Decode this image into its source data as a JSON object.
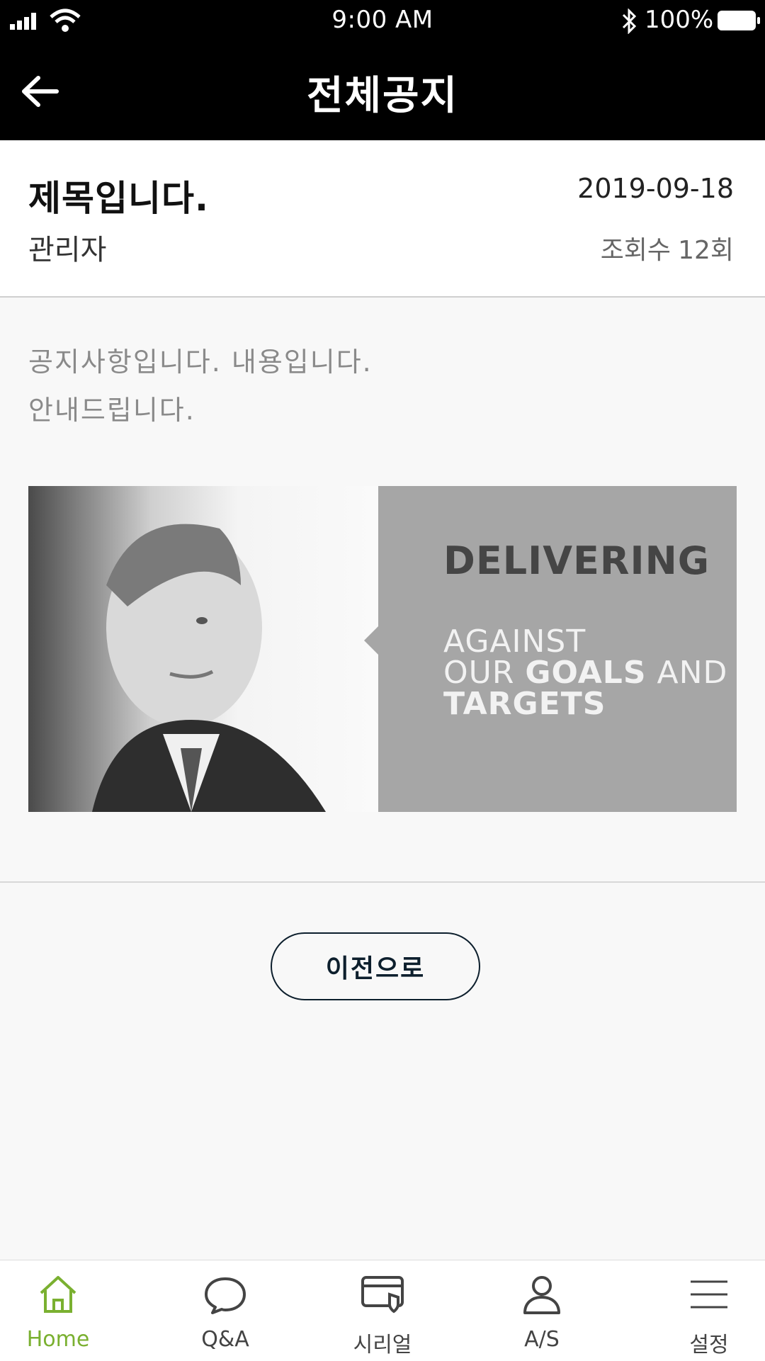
{
  "status_bar": {
    "time": "9:00 AM",
    "battery_percent": "100%"
  },
  "header": {
    "title": "전체공지"
  },
  "post": {
    "title": "제목입니다.",
    "date": "2019-09-18",
    "author": "관리자",
    "views_label": "조회수",
    "views_count": "12회",
    "content_lines": [
      "공지사항입니다. 내용입니다.",
      "안내드립니다."
    ]
  },
  "banner": {
    "headline": "DELIVERING",
    "sub_line1": "AGAINST",
    "sub_line2_a": "OUR ",
    "sub_line2_b": "GOALS",
    "sub_line2_c": " AND",
    "sub_line3": "TARGETS"
  },
  "buttons": {
    "prev": "이전으로"
  },
  "tabbar": {
    "items": [
      {
        "label": "Home",
        "icon": "home-icon",
        "active": true
      },
      {
        "label": "Q&A",
        "icon": "chat-bubble-icon",
        "active": false
      },
      {
        "label": "시리얼",
        "icon": "serial-card-icon",
        "active": false
      },
      {
        "label": "A/S",
        "icon": "person-icon",
        "active": false
      },
      {
        "label": "설정",
        "icon": "menu-icon",
        "active": false
      }
    ]
  },
  "colors": {
    "accent": "#7ab030",
    "header_bg": "#000000",
    "button_border": "#0d1f2d"
  }
}
